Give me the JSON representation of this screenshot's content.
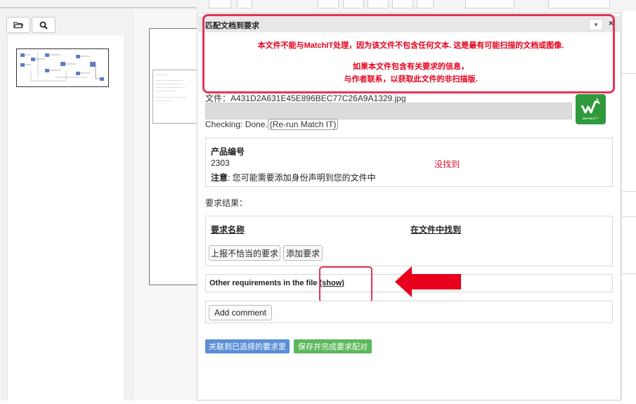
{
  "dialog": {
    "title": "匹配文档到要求",
    "collapse_glyph": "▾",
    "close_glyph": "×"
  },
  "warning": {
    "line1": "本文件不能与MatchIT处理，因为该文件不包含任何文本. 这是最有可能扫描的文档或图像.",
    "line2": "如果本文件包含有关要求的信息，",
    "line3": "与作者联系，以获取此文件的非扫描版."
  },
  "file": {
    "label": "文件：A431D2A631E45E896BEC77C26A9A1329.jpg",
    "status_prefix": "Checking: Done.",
    "rerun_link": "(Re-run Match IT)"
  },
  "logo": {
    "text": "MATCH IT™"
  },
  "product": {
    "label": "产品编号",
    "number": "2303",
    "status": "没找到",
    "note_bold": "注意",
    "note_text": ": 您可能需要添加身份声明到您的文件中"
  },
  "requirements": {
    "result_label": "要求结果：",
    "col_name": "要求名称",
    "col_found": "在文件中找到",
    "report_button": "上报不恰当的要求",
    "add_button": "添加要求"
  },
  "other": {
    "text": "Other requirements in the file ",
    "show_link": "(show)"
  },
  "comment": {
    "button": "Add comment"
  },
  "actions": {
    "link_selected": "关联到已选择的要求里",
    "save_complete": "保存并完成要求配对"
  },
  "colors": {
    "highlight": "#e53355",
    "warning_text": "#e8001c",
    "arrow": "#e8001c",
    "blue_button": "#5b8fd6",
    "green_button": "#5cb85c",
    "logo_green": "#2e9a3c"
  },
  "icons": {
    "open": "folder-open-icon",
    "search": "search-icon",
    "arrow": "red-arrow-left"
  }
}
